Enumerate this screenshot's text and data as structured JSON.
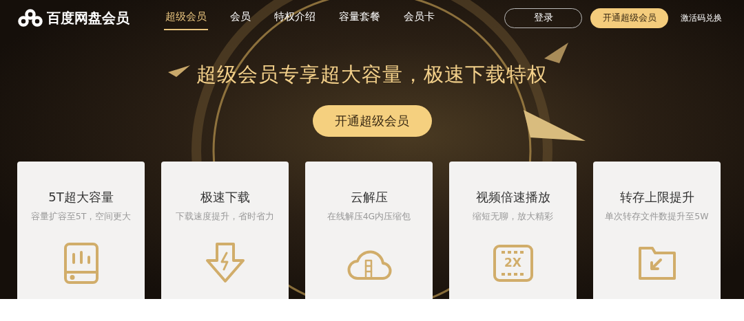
{
  "header": {
    "brand": "百度网盘会员",
    "nav": [
      {
        "label": "超级会员",
        "selected": true
      },
      {
        "label": "会员",
        "selected": false
      },
      {
        "label": "特权介绍",
        "selected": false
      },
      {
        "label": "容量套餐",
        "selected": false
      },
      {
        "label": "会员卡",
        "selected": false
      }
    ],
    "login_button": "登录",
    "open_button": "开通超级会员",
    "redeem_link": "激活码兑换"
  },
  "hero": {
    "title": "超级会员专享超大容量，极速下载特权",
    "button": "开通超级会员"
  },
  "cards": [
    {
      "kind": "storage",
      "title": "5T超大容量",
      "subtitle": "容量扩容至5T，空间更大"
    },
    {
      "kind": "download",
      "title": "极速下载",
      "subtitle": "下载速度提升，省时省力"
    },
    {
      "kind": "cloud",
      "title": "云解压",
      "subtitle": "在线解压4G内压缩包"
    },
    {
      "kind": "video",
      "title": "视频倍速播放",
      "subtitle": "缩短无聊，放大精彩",
      "icon_label": "2X"
    },
    {
      "kind": "folder",
      "title": "转存上限提升",
      "subtitle": "单次转存文件数提升至5W"
    }
  ]
}
